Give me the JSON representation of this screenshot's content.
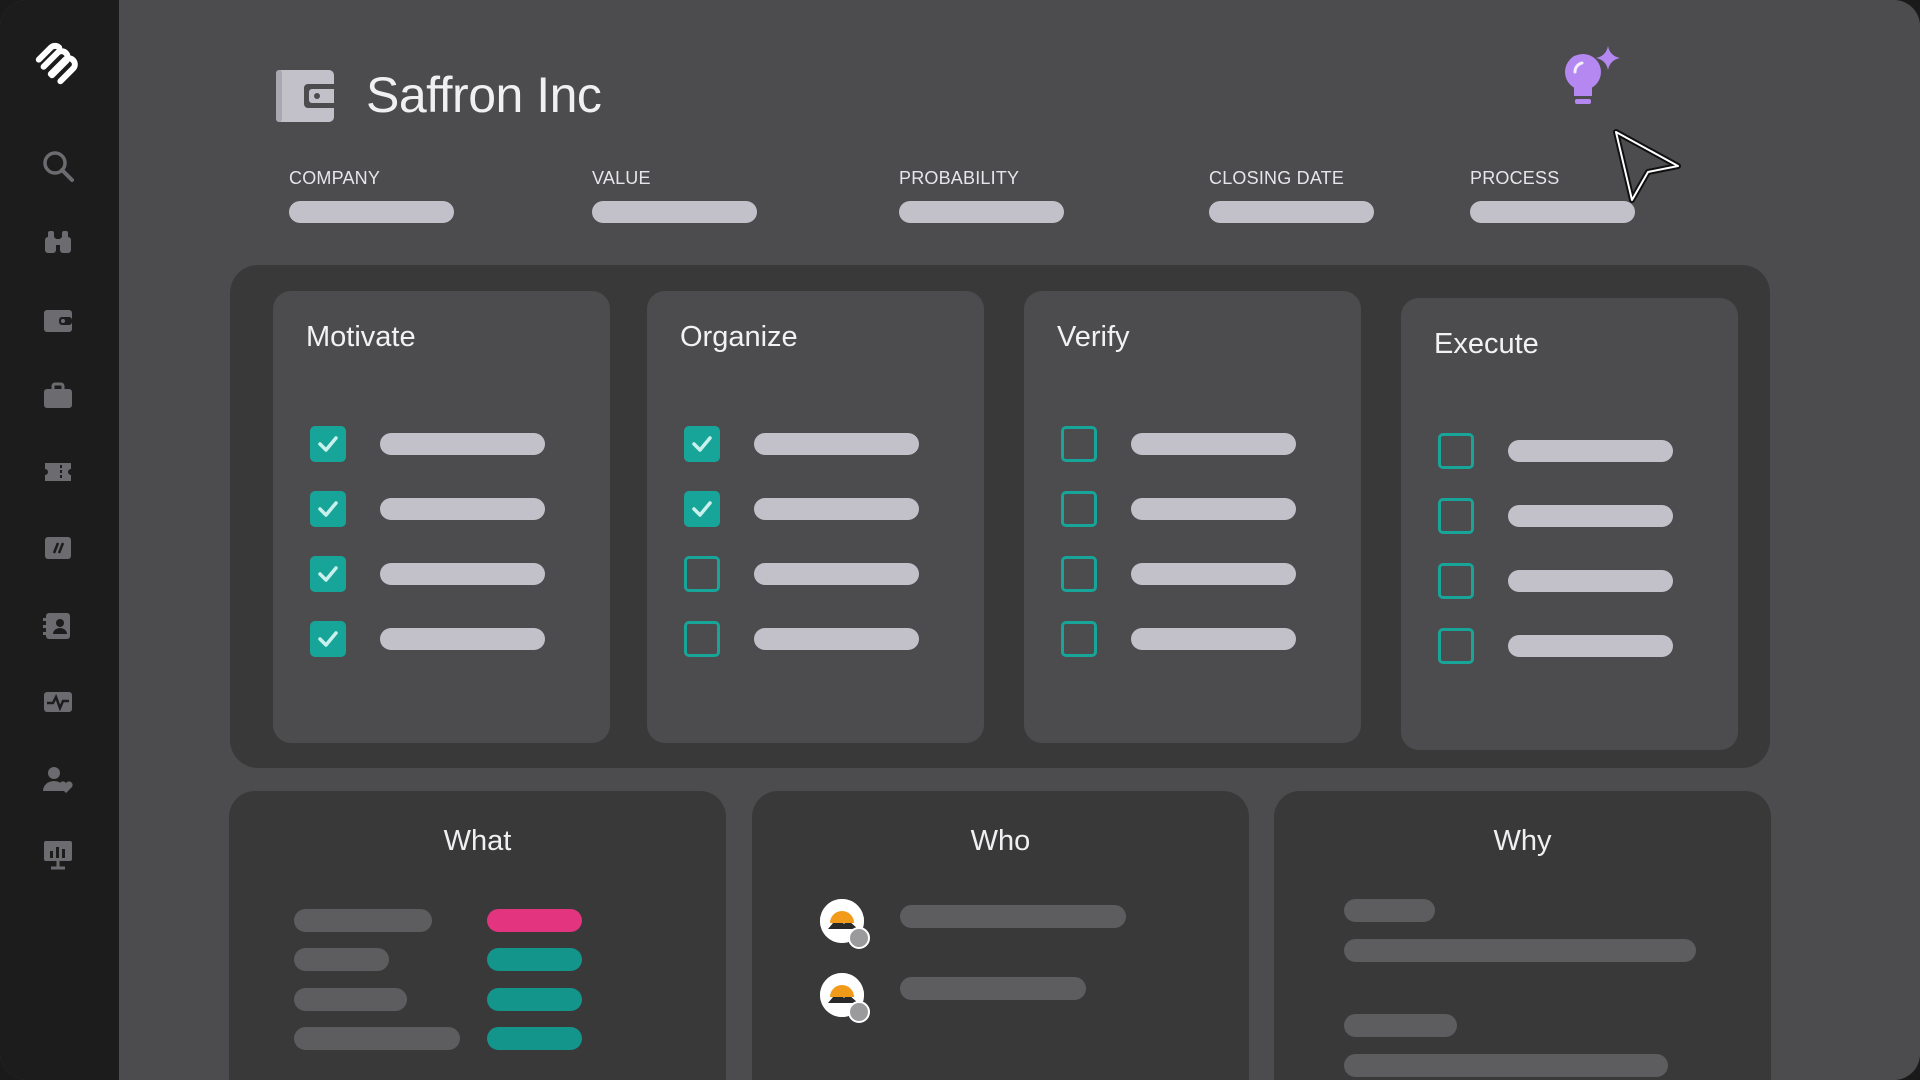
{
  "app": {
    "title": "Saffron Inc"
  },
  "sidebar": {
    "items": [
      {
        "name": "search-icon"
      },
      {
        "name": "binoculars-icon"
      },
      {
        "name": "wallet-icon"
      },
      {
        "name": "briefcase-icon"
      },
      {
        "name": "ticket-icon"
      },
      {
        "name": "slash-tag-icon"
      },
      {
        "name": "contact-card-icon"
      },
      {
        "name": "activity-icon"
      },
      {
        "name": "user-heart-icon"
      },
      {
        "name": "presentation-chart-icon"
      }
    ]
  },
  "fields": [
    {
      "label": "COMPANY"
    },
    {
      "label": "VALUE"
    },
    {
      "label": "PROBABILITY"
    },
    {
      "label": "CLOSING DATE"
    },
    {
      "label": "PROCESS"
    }
  ],
  "stages": [
    {
      "title": "Motivate",
      "tasks": [
        true,
        true,
        true,
        true
      ]
    },
    {
      "title": "Organize",
      "tasks": [
        true,
        true,
        false,
        false
      ]
    },
    {
      "title": "Verify",
      "tasks": [
        false,
        false,
        false,
        false
      ]
    },
    {
      "title": "Execute",
      "tasks": [
        false,
        false,
        false,
        false
      ]
    }
  ],
  "cards": {
    "what": {
      "title": "What"
    },
    "who": {
      "title": "Who"
    },
    "why": {
      "title": "Why"
    }
  },
  "colors": {
    "accent_teal": "#17a59a",
    "accent_pink": "#e3347f",
    "ai_purple": "#b488f0"
  }
}
